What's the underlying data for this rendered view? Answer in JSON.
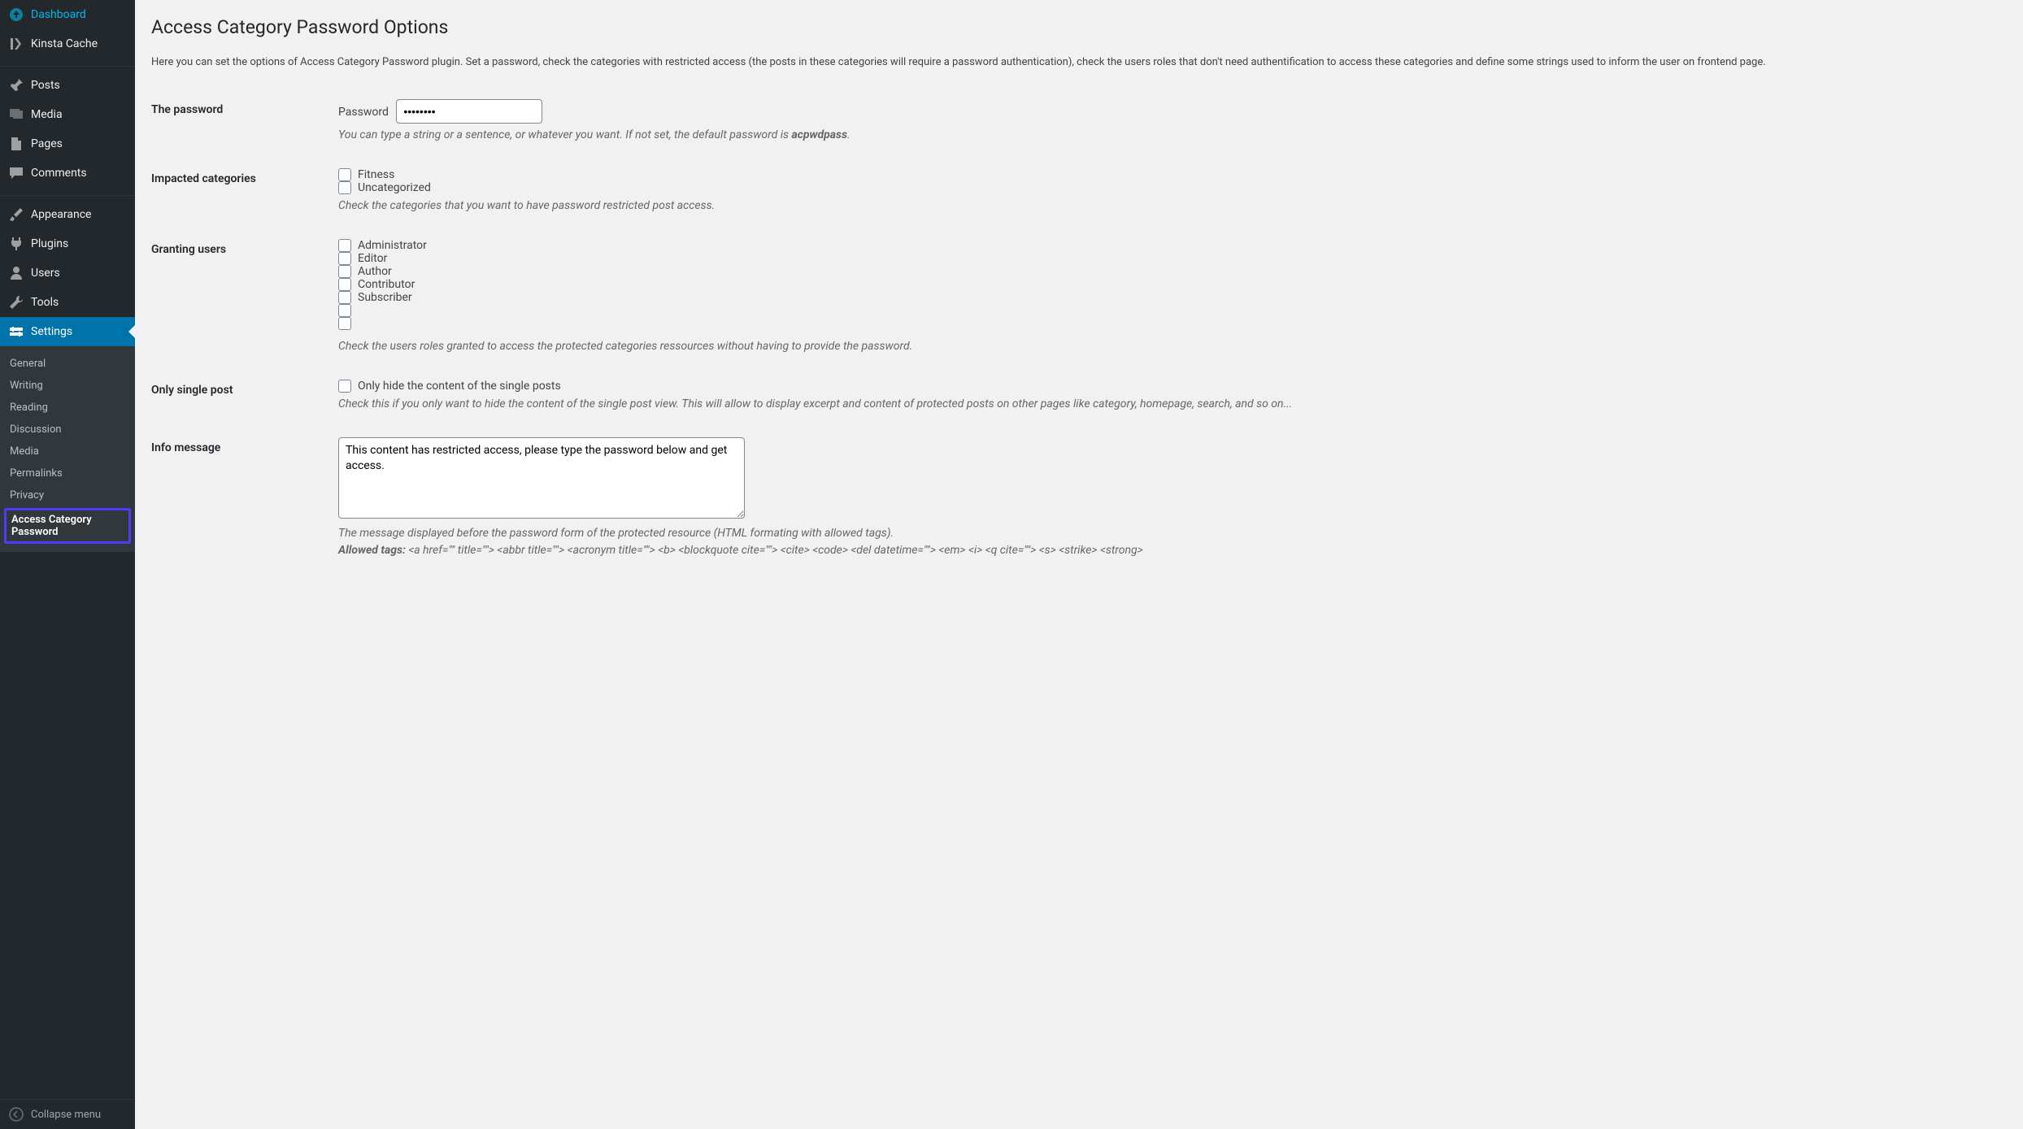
{
  "sidebar": {
    "items": [
      {
        "label": "Dashboard",
        "icon": "dashboard"
      },
      {
        "label": "Kinsta Cache",
        "icon": "kinsta"
      },
      {
        "label": "Posts",
        "icon": "pin"
      },
      {
        "label": "Media",
        "icon": "media"
      },
      {
        "label": "Pages",
        "icon": "page"
      },
      {
        "label": "Comments",
        "icon": "comment"
      },
      {
        "label": "Appearance",
        "icon": "brush"
      },
      {
        "label": "Plugins",
        "icon": "plug"
      },
      {
        "label": "Users",
        "icon": "user"
      },
      {
        "label": "Tools",
        "icon": "wrench"
      },
      {
        "label": "Settings",
        "icon": "settings"
      }
    ],
    "submenu": [
      "General",
      "Writing",
      "Reading",
      "Discussion",
      "Media",
      "Permalinks",
      "Privacy",
      "Access Category Password"
    ],
    "collapse": "Collapse menu"
  },
  "page": {
    "title": "Access Category Password Options",
    "intro": "Here you can set the options of Access Category Password plugin. Set a password, check the categories with restricted access (the posts in these categories will require a password authentication), check the users roles that don't need authentification to access these categories and define some strings used to inform the user on frontend page."
  },
  "form": {
    "password": {
      "th": "The password",
      "label": "Password",
      "value": "••••••••",
      "desc_prefix": "You can type a string or a sentence, or whatever you want. If not set, the default password is ",
      "desc_strong": "acpwdpass",
      "desc_suffix": "."
    },
    "impacted": {
      "th": "Impacted categories",
      "options": [
        "Fitness",
        "Uncategorized"
      ],
      "desc": "Check the categories that you want to have password restricted post access."
    },
    "granting": {
      "th": "Granting users",
      "options": [
        "Administrator",
        "Editor",
        "Author",
        "Contributor",
        "Subscriber",
        "",
        ""
      ],
      "desc": "Check the users roles granted to access the protected categories ressources without having to provide the password."
    },
    "single": {
      "th": "Only single post",
      "label": "Only hide the content of the single posts",
      "desc": "Check this if you only want to hide the content of the single post view. This will allow to display excerpt and content of protected posts on other pages like category, homepage, search, and so on..."
    },
    "info": {
      "th": "Info message",
      "value": "This content has restricted access, please type the password below and get access.",
      "desc": "The message displayed before the password form of the protected resource (HTML formating with allowed tags).",
      "allowed_label": "Allowed tags:",
      "allowed_tags": "<a href=\"\" title=\"\"> <abbr title=\"\"> <acronym title=\"\"> <b> <blockquote cite=\"\"> <cite> <code> <del datetime=\"\"> <em> <i> <q cite=\"\"> <s> <strike> <strong>"
    }
  }
}
